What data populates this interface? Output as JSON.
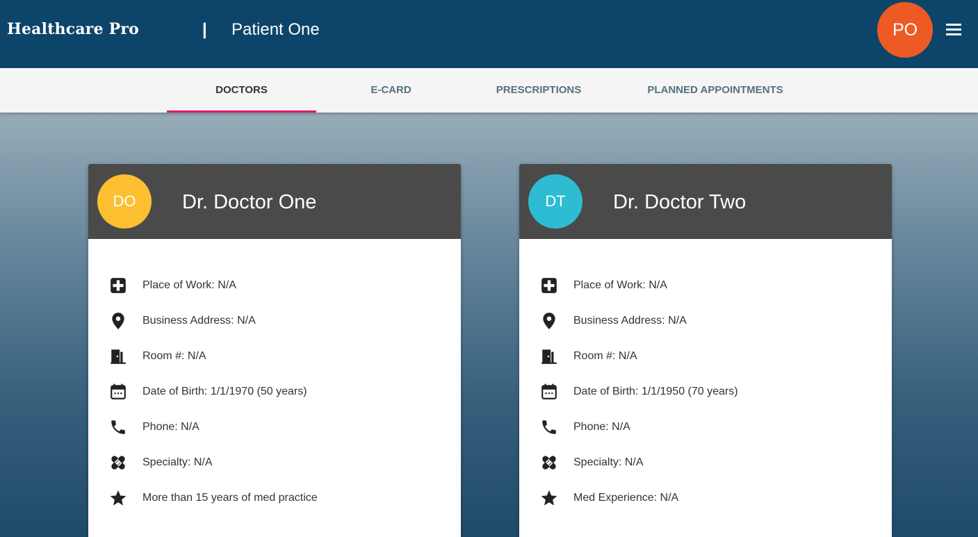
{
  "header": {
    "brand": "Healthcare Pro",
    "divider": "|",
    "patient_name": "Patient One",
    "user_initials": "PO",
    "menu_icon": "hamburger-menu-icon"
  },
  "tabs": [
    {
      "label": "DOCTORS",
      "active": true
    },
    {
      "label": "E-CARD",
      "active": false
    },
    {
      "label": "PRESCRIPTIONS",
      "active": false
    },
    {
      "label": "PLANNED APPOINTMENTS",
      "active": false
    }
  ],
  "doctors": [
    {
      "initials": "DO",
      "avatar_color": "#fbbf30",
      "name": "Dr. Doctor One",
      "fields": [
        {
          "icon": "hospital-icon",
          "text": "Place of Work: N/A"
        },
        {
          "icon": "location-pin-icon",
          "text": "Business Address: N/A"
        },
        {
          "icon": "door-icon",
          "text": "Room #: N/A"
        },
        {
          "icon": "calendar-icon",
          "text": "Date of Birth: 1/1/1970 (50 years)"
        },
        {
          "icon": "phone-icon",
          "text": "Phone: N/A"
        },
        {
          "icon": "bandage-icon",
          "text": "Specialty: N/A"
        },
        {
          "icon": "star-icon",
          "text": "More than 15 years of med practice"
        }
      ]
    },
    {
      "initials": "DT",
      "avatar_color": "#2ebcd3",
      "name": "Dr. Doctor Two",
      "fields": [
        {
          "icon": "hospital-icon",
          "text": "Place of Work: N/A"
        },
        {
          "icon": "location-pin-icon",
          "text": "Business Address: N/A"
        },
        {
          "icon": "door-icon",
          "text": "Room #: N/A"
        },
        {
          "icon": "calendar-icon",
          "text": "Date of Birth: 1/1/1950 (70 years)"
        },
        {
          "icon": "phone-icon",
          "text": "Phone: N/A"
        },
        {
          "icon": "bandage-icon",
          "text": "Specialty: N/A"
        },
        {
          "icon": "star-icon",
          "text": "Med Experience: N/A"
        }
      ]
    }
  ],
  "colors": {
    "app_bar": "#0d446a",
    "user_avatar": "#ee5a24",
    "tab_indicator": "#e3176f",
    "card_header": "#4a4a4a"
  }
}
